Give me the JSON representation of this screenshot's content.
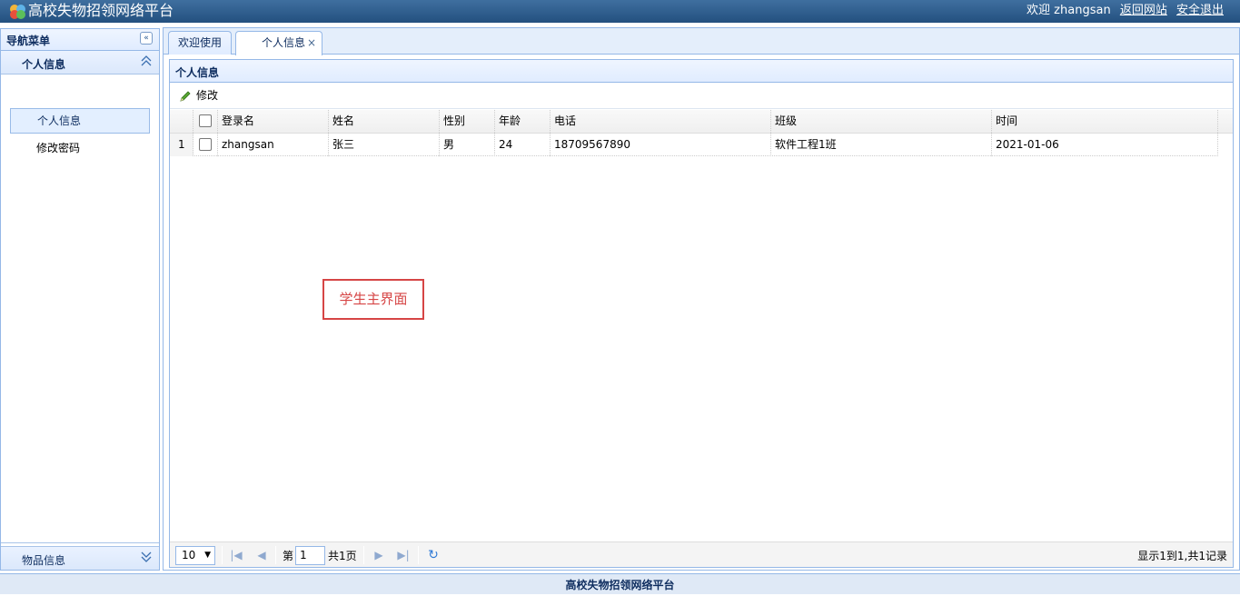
{
  "header": {
    "app_title": "高校失物招领网络平台",
    "welcome": "欢迎 zhangsan",
    "back_link": "返回网站",
    "logout_link": "安全退出"
  },
  "nav": {
    "title": "导航菜单",
    "section_personal": "个人信息",
    "items": [
      "个人信息",
      "修改密码"
    ],
    "section_items": "物品信息"
  },
  "tabs": [
    {
      "label": "欢迎使用"
    },
    {
      "label": "个人信息"
    }
  ],
  "panel": {
    "title": "个人信息",
    "edit_label": "修改"
  },
  "table": {
    "columns": [
      "登录名",
      "姓名",
      "性别",
      "年龄",
      "电话",
      "班级",
      "时间"
    ],
    "rows": [
      {
        "index": "1",
        "login": "zhangsan",
        "name": "张三",
        "gender": "男",
        "age": "24",
        "phone": "18709567890",
        "class": "软件工程1班",
        "time": "2021-01-06"
      }
    ]
  },
  "annotation": "学生主界面",
  "pager": {
    "page_size": "10",
    "page_prefix": "第",
    "page_value": "1",
    "page_suffix": "共1页",
    "info": "显示1到1,共1记录"
  },
  "footer": "高校失物招领网络平台"
}
